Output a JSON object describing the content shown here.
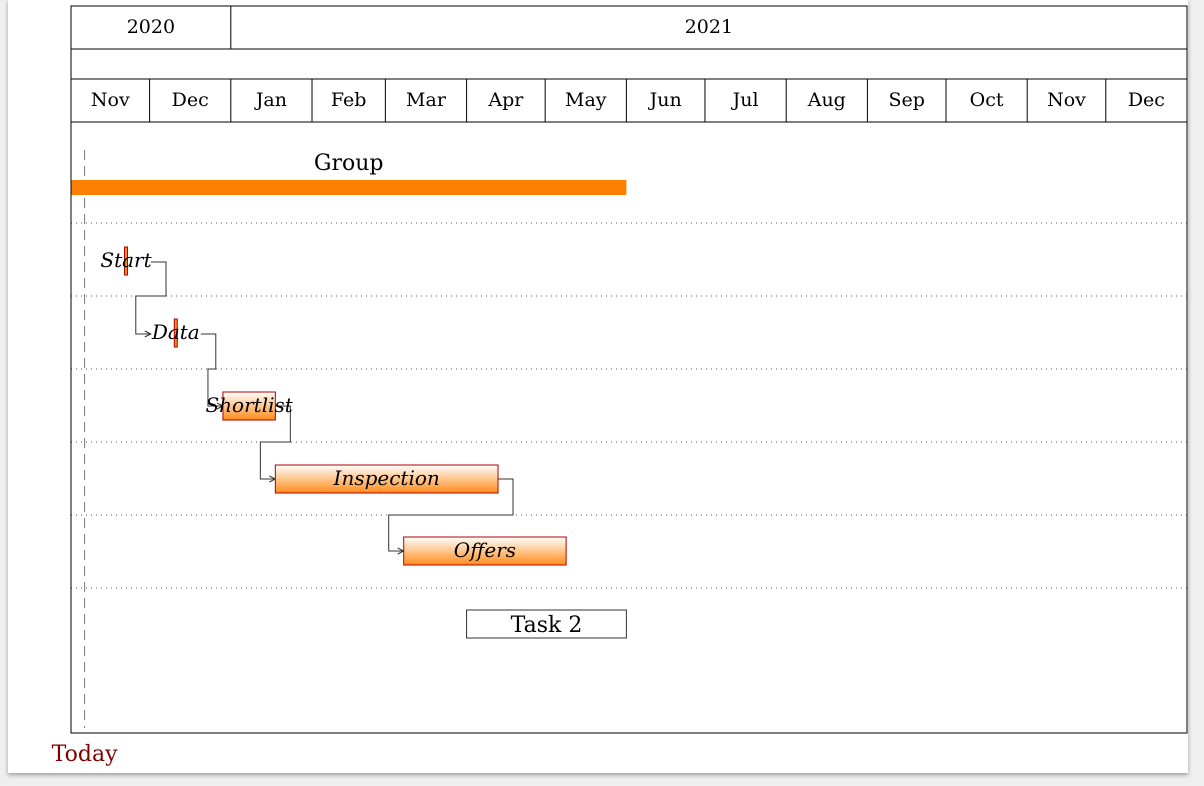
{
  "chart_data": {
    "type": "gantt",
    "title": "",
    "timeline": {
      "start": "2020-11-01",
      "end": "2021-12-31",
      "years": [
        {
          "label": "2020",
          "start": "2020-11-01",
          "end": "2020-12-31"
        },
        {
          "label": "2021",
          "start": "2021-01-01",
          "end": "2021-12-31"
        }
      ],
      "months": [
        {
          "label": "Nov",
          "start": "2020-11-01",
          "end": "2020-11-30"
        },
        {
          "label": "Dec",
          "start": "2020-12-01",
          "end": "2020-12-31"
        },
        {
          "label": "Jan",
          "start": "2021-01-01",
          "end": "2021-01-31"
        },
        {
          "label": "Feb",
          "start": "2021-02-01",
          "end": "2021-02-28"
        },
        {
          "label": "Mar",
          "start": "2021-03-01",
          "end": "2021-03-31"
        },
        {
          "label": "Apr",
          "start": "2021-04-01",
          "end": "2021-04-30"
        },
        {
          "label": "May",
          "start": "2021-05-01",
          "end": "2021-05-31"
        },
        {
          "label": "Jun",
          "start": "2021-06-01",
          "end": "2021-06-30"
        },
        {
          "label": "Jul",
          "start": "2021-07-01",
          "end": "2021-07-31"
        },
        {
          "label": "Aug",
          "start": "2021-08-01",
          "end": "2021-08-31"
        },
        {
          "label": "Sep",
          "start": "2021-09-01",
          "end": "2021-09-30"
        },
        {
          "label": "Oct",
          "start": "2021-10-01",
          "end": "2021-10-31"
        },
        {
          "label": "Nov",
          "start": "2021-11-01",
          "end": "2021-11-30"
        },
        {
          "label": "Dec",
          "start": "2021-12-01",
          "end": "2021-12-31"
        }
      ]
    },
    "group": {
      "label": "Group",
      "start": "2020-11-01",
      "end": "2021-05-31",
      "color": "#ff8000"
    },
    "tasks": [
      {
        "label": "Start",
        "start": "2020-11-21",
        "end": "2020-11-22",
        "row": 1,
        "style": "milestone"
      },
      {
        "label": "Data",
        "start": "2020-12-10",
        "end": "2020-12-11",
        "row": 2,
        "style": "milestone"
      },
      {
        "label": "Shortlist",
        "start": "2020-12-29",
        "end": "2021-01-17",
        "row": 3,
        "style": "bar"
      },
      {
        "label": "Inspection",
        "start": "2021-01-18",
        "end": "2021-04-12",
        "row": 4,
        "style": "bar"
      },
      {
        "label": "Offers",
        "start": "2021-03-08",
        "end": "2021-05-08",
        "row": 5,
        "style": "bar"
      },
      {
        "label": "Task 2",
        "start": "2021-04-01",
        "end": "2021-05-31",
        "row": 6,
        "style": "plain"
      }
    ],
    "links": [
      {
        "from": "Start",
        "to": "Data"
      },
      {
        "from": "Data",
        "to": "Shortlist"
      },
      {
        "from": "Shortlist",
        "to": "Inspection"
      },
      {
        "from": "Inspection",
        "to": "Offers"
      }
    ],
    "today": {
      "label": "Today",
      "date": "2020-11-06",
      "color": "#800000"
    },
    "colors": {
      "bar_top": "#ffffff",
      "bar_bottom": "#ff8c1a",
      "bar_border": "#b00000",
      "group_bar": "#ff8000",
      "grid": "#555555"
    }
  }
}
